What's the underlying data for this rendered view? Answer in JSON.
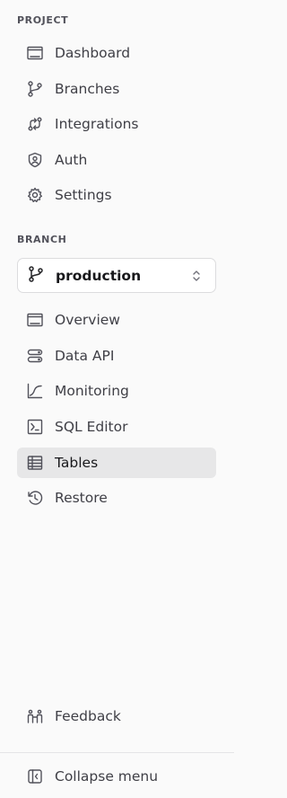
{
  "project": {
    "section_label": "PROJECT",
    "items": [
      {
        "label": "Dashboard",
        "icon": "dashboard-icon"
      },
      {
        "label": "Branches",
        "icon": "branch-icon"
      },
      {
        "label": "Integrations",
        "icon": "integrations-icon"
      },
      {
        "label": "Auth",
        "icon": "shield-icon"
      },
      {
        "label": "Settings",
        "icon": "gear-icon"
      }
    ]
  },
  "branch": {
    "section_label": "BRANCH",
    "selector": {
      "value": "production",
      "icon": "branch-icon",
      "chevron": "chevron-up-down-icon"
    },
    "items": [
      {
        "label": "Overview",
        "icon": "overview-icon"
      },
      {
        "label": "Data API",
        "icon": "data-api-icon"
      },
      {
        "label": "Monitoring",
        "icon": "monitoring-icon"
      },
      {
        "label": "SQL Editor",
        "icon": "sql-editor-icon"
      },
      {
        "label": "Tables",
        "icon": "table-icon",
        "active": true
      },
      {
        "label": "Restore",
        "icon": "restore-icon"
      }
    ]
  },
  "footer": {
    "feedback_label": "Feedback",
    "collapse_label": "Collapse menu"
  },
  "colors": {
    "background": "#fafafa",
    "active_item_bg": "#e7e7e8",
    "text": "#3f3f46",
    "divider": "#e4e4e7"
  }
}
